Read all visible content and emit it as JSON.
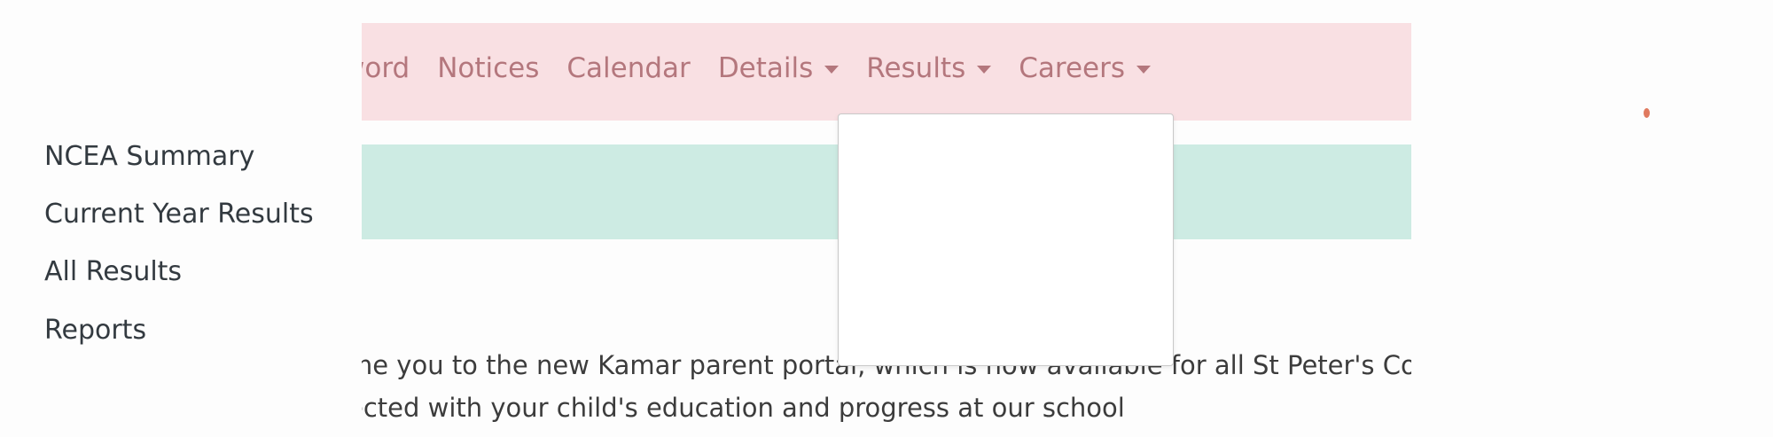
{
  "navbar": {
    "items": [
      {
        "label": "word",
        "has_caret": false
      },
      {
        "label": "Notices",
        "has_caret": false
      },
      {
        "label": "Calendar",
        "has_caret": false
      },
      {
        "label": "Details",
        "has_caret": true
      },
      {
        "label": "Results",
        "has_caret": true
      },
      {
        "label": "Careers",
        "has_caret": true
      }
    ]
  },
  "results_dropdown": {
    "items": [
      "NCEA Summary",
      "Current Year Results",
      "All Results",
      "Reports"
    ]
  },
  "content": {
    "line1": "me you to the new Kamar parent portal, which is now available for all St Peter's Coll",
    "line2": "ected with your child's education and progress at our school"
  },
  "colors": {
    "navbar_bg": "#f9e0e3",
    "nav_link": "#b4777d",
    "alert_bg": "#cdebe3",
    "dropdown_text": "#333a40"
  }
}
